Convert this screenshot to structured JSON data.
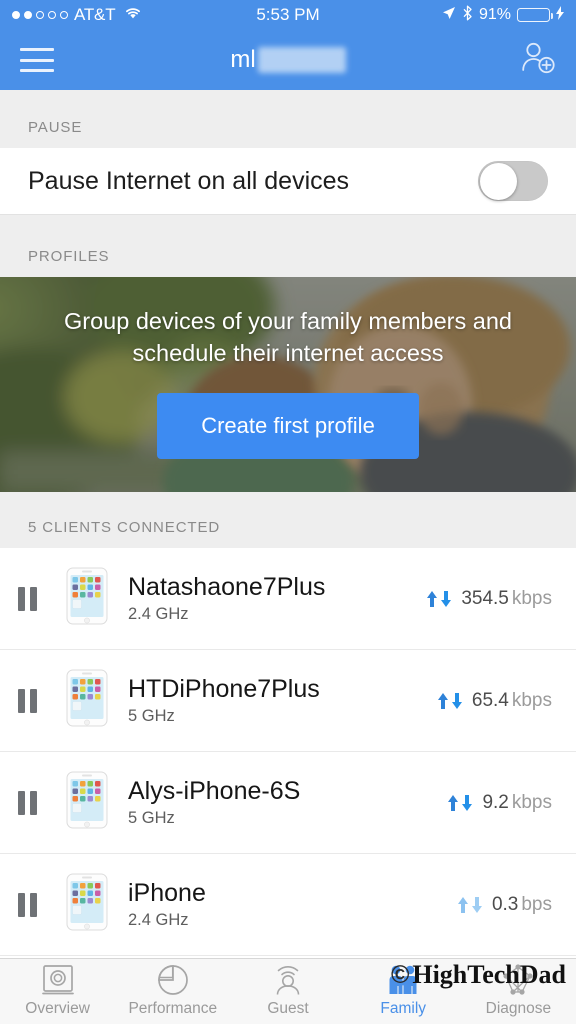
{
  "status_bar": {
    "signal_dots_filled": 2,
    "signal_dots_total": 5,
    "carrier": "AT&T",
    "wifi_icon": "wifi-icon",
    "time": "5:53 PM",
    "location_icon": "location-arrow-icon",
    "bluetooth_icon": "bluetooth-icon",
    "battery_percent": "91%",
    "battery_level": 91,
    "charging_icon": "lightning-bolt-icon",
    "battery_color": "#4ddb5a"
  },
  "nav_bar": {
    "menu_icon": "hamburger-menu-icon",
    "title": "ml",
    "title_redacted": true,
    "add_user_icon": "add-user-icon",
    "background_color": "#4a90e8"
  },
  "pause_section": {
    "header": "PAUSE",
    "row_label": "Pause Internet on all devices",
    "toggle_state": "off"
  },
  "profiles_section": {
    "header": "PROFILES",
    "banner_text": "Group devices of your family members and schedule their internet access",
    "button_label": "Create first profile",
    "button_color": "#3d8bf2"
  },
  "clients_section": {
    "header": "5 CLIENTS CONNECTED",
    "count": 5,
    "devices": [
      {
        "pause_icon": "pause-icon",
        "device_icon": "iphone-icon",
        "name": "Natashaone7Plus",
        "band": "2.4 GHz",
        "speed_value": "354.5",
        "speed_unit": "kbps",
        "activity": "active"
      },
      {
        "pause_icon": "pause-icon",
        "device_icon": "iphone-icon",
        "name": "HTDiPhone7Plus",
        "band": "5 GHz",
        "speed_value": "65.4",
        "speed_unit": "kbps",
        "activity": "active"
      },
      {
        "pause_icon": "pause-icon",
        "device_icon": "iphone-icon",
        "name": "Alys-iPhone-6S",
        "band": "5 GHz",
        "speed_value": "9.2",
        "speed_unit": "kbps",
        "activity": "active"
      },
      {
        "pause_icon": "pause-icon",
        "device_icon": "iphone-icon",
        "name": "iPhone",
        "band": "2.4 GHz",
        "speed_value": "0.3",
        "speed_unit": "bps",
        "activity": "idle"
      }
    ]
  },
  "tab_bar": {
    "active_index": 3,
    "active_color": "#4a90e8",
    "inactive_color": "#9a9a9a",
    "tabs": [
      {
        "label": "Overview",
        "icon": "router-icon"
      },
      {
        "label": "Performance",
        "icon": "pie-chart-icon"
      },
      {
        "label": "Guest",
        "icon": "guest-person-icon"
      },
      {
        "label": "Family",
        "icon": "family-people-icon"
      },
      {
        "label": "Diagnose",
        "icon": "network-mesh-icon"
      }
    ]
  },
  "watermark": {
    "copyright": "©",
    "text": "HighTechDad"
  }
}
